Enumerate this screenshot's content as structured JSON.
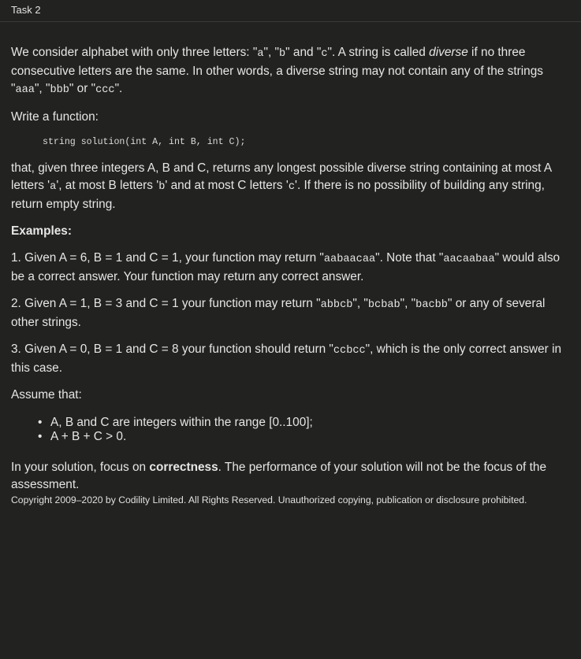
{
  "header": {
    "title": "Task 2"
  },
  "intro": {
    "t1": "We consider alphabet with only three letters: \"",
    "c1": "a",
    "t2": "\", \"",
    "c2": "b",
    "t3": "\" and \"",
    "c3": "c",
    "t4": "\". A string is called ",
    "em": "diverse",
    "t5": " if no three consecutive letters are the same. In other words, a diverse string may not contain any of the strings \"",
    "c4": "aaa",
    "t6": "\", \"",
    "c5": "bbb",
    "t7": "\" or \"",
    "c6": "ccc",
    "t8": "\"."
  },
  "write": "Write a function:",
  "code": "string solution(int A, int B, int C);",
  "that": {
    "t1": "that, given three integers A, B and C, returns any longest possible diverse string containing at most A letters '",
    "c1": "a",
    "t2": "', at most B letters '",
    "c2": "b",
    "t3": "' and at most C letters '",
    "c3": "c",
    "t4": "'. If there is no possibility of building any string, return empty string."
  },
  "examples_heading": "Examples:",
  "ex1": {
    "t1": "1. Given A = 6, B = 1 and C = 1, your function may return \"",
    "c1": "aabaacaa",
    "t2": "\". Note that \"",
    "c2": "aacaabaa",
    "t3": "\" would also be a correct answer. Your function may return any correct answer."
  },
  "ex2": {
    "t1": "2. Given A = 1, B = 3 and C = 1 your function may return \"",
    "c1": "abbcb",
    "t2": "\", \"",
    "c2": "bcbab",
    "t3": "\", \"",
    "c3": "bacbb",
    "t4": "\" or any of several other strings."
  },
  "ex3": {
    "t1": "3. Given A = 0, B = 1 and C = 8 your function should return \"",
    "c1": "ccbcc",
    "t2": "\", which is the only correct answer in this case."
  },
  "assume": "Assume that:",
  "constraints": [
    "A, B and C are integers within the range [0..100];",
    "A + B + C > 0."
  ],
  "focus": {
    "t1": "In your solution, focus on ",
    "strong": "correctness",
    "t2": ". The performance of your solution will not be the focus of the assessment."
  },
  "copyright": "Copyright 2009–2020 by Codility Limited. All Rights Reserved. Unauthorized copying, publication or disclosure prohibited."
}
